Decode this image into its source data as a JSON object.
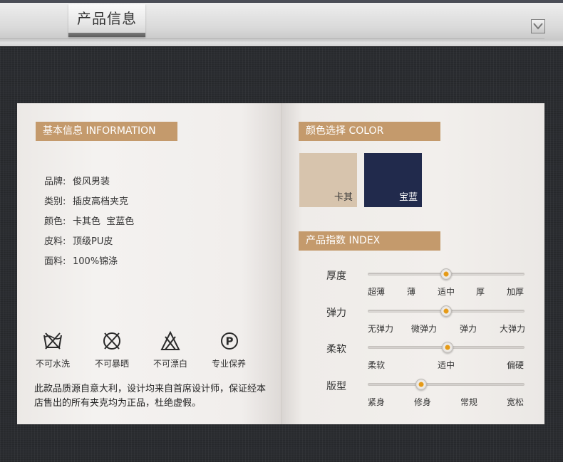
{
  "header": {
    "title": "产品信息"
  },
  "info": {
    "heading": "基本信息 INFORMATION",
    "specs": [
      {
        "label": "品牌:",
        "value": "俊风男装"
      },
      {
        "label": "类别:",
        "value": "插皮高档夹克"
      },
      {
        "label": "颜色:",
        "value": "卡其色  宝蓝色"
      },
      {
        "label": "皮料:",
        "value": "顶级PU皮"
      },
      {
        "label": "面料:",
        "value": "100%锦涤"
      }
    ],
    "care": [
      {
        "icon": "no-wash-icon",
        "label": "不可水洗"
      },
      {
        "icon": "no-tumble-dry-icon",
        "label": "不可暴晒"
      },
      {
        "icon": "no-bleach-icon",
        "label": "不可漂白"
      },
      {
        "icon": "professional-care-icon",
        "label": "专业保养"
      }
    ],
    "note": "此款品质源自意大利，设计均来自首席设计师，保证经本店售出的所有夹克均为正品，杜绝虚假。"
  },
  "colors": {
    "heading": "颜色选择 COLOR",
    "swatches": [
      {
        "name": "卡其",
        "color": "#d7c4ad",
        "text_color": "#333333"
      },
      {
        "name": "宝蓝",
        "color": "#212a4c",
        "text_color": "#ffffff"
      }
    ]
  },
  "index": {
    "heading": "产品指数 INDEX",
    "rows": [
      {
        "label": "厚度",
        "ticks": [
          "超薄",
          "薄",
          "适中",
          "厚",
          "加厚"
        ],
        "value": 0.5
      },
      {
        "label": "弹力",
        "ticks": [
          "无弹力",
          "微弹力",
          "弹力",
          "大弹力"
        ],
        "value": 0.5
      },
      {
        "label": "柔软",
        "ticks": [
          "柔软",
          "适中",
          "偏硬"
        ],
        "value": 0.51
      },
      {
        "label": "版型",
        "ticks": [
          "紧身",
          "修身",
          "常规",
          "宽松"
        ],
        "value": 0.34
      }
    ]
  }
}
